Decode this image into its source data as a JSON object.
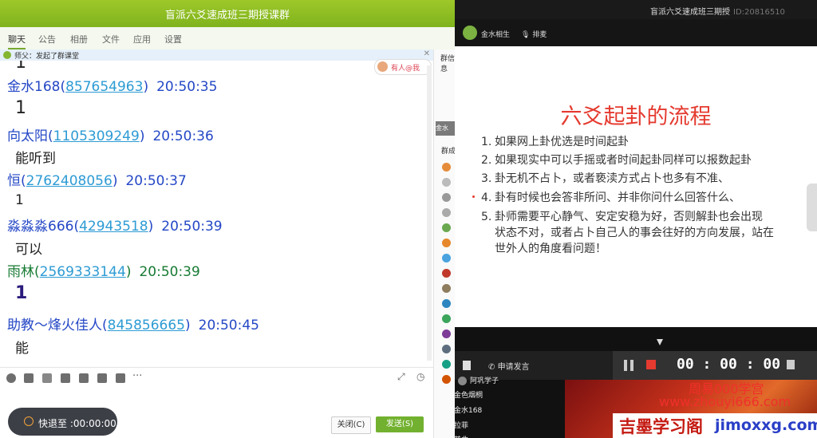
{
  "qq": {
    "title": "盲派六爻速成班三期授课群",
    "tabs": [
      "聊天",
      "公告",
      "相册",
      "文件",
      "应用",
      "设置"
    ],
    "notice": "师父：发起了群课堂",
    "mention": "有人@我",
    "messages": [
      {
        "name": "金水168",
        "qq": "857654963",
        "time": "20:50:35",
        "text": "1"
      },
      {
        "name": "向太阳",
        "qq": "1105309249",
        "time": "20:50:36",
        "text": "能听到"
      },
      {
        "name": "恒",
        "qq": "2762408056",
        "time": "20:50:37",
        "text": "1"
      },
      {
        "name": "淼淼淼666",
        "qq": "42943518",
        "time": "20:50:39",
        "text": "可以"
      },
      {
        "name": "雨林",
        "qq": "2569333144",
        "time": "20:50:39",
        "text": "1"
      },
      {
        "name": "助教～烽火佳人",
        "qq": "845856665",
        "time": "20:50:45",
        "text": "能"
      }
    ],
    "retreat": "快退至 :00:00:00",
    "close_btn": "关闭(C)",
    "send_btn": "发送(S)"
  },
  "group": {
    "info_label": "群信息",
    "members_label": "群成",
    "members": [
      "阿巩学子",
      "金色烟桐",
      "金水168",
      "拉菲",
      "普曲"
    ]
  },
  "live": {
    "title": "盲派六爻速成班三期授",
    "room_id": "ID:20816510",
    "host": "金水相生",
    "mic": "排麦",
    "slide_title": "六爻起卦的流程",
    "items": [
      {
        "n": "1.",
        "lines": [
          "如果网上卦优选是时间起卦"
        ]
      },
      {
        "n": "2.",
        "lines": [
          "如果现实中可以手摇或者时间起卦同样可以报数起卦"
        ]
      },
      {
        "n": "3.",
        "lines": [
          "卦无机不占卜，或者亵渎方式占卜也多有不准、"
        ]
      },
      {
        "n": "4.",
        "lines": [
          "卦有时候也会答非所问、并非你问什么回答什么、"
        ]
      },
      {
        "n": "5.",
        "lines": [
          "卦师需要平心静气、安定安稳为好，否则解卦也会出现",
          "状态不对，或者占卜自己人的事会往好的方向发展，站在",
          "世外人的角度看问题！"
        ]
      }
    ],
    "apply": "申请发言",
    "timer": "00 : 00 : 00",
    "watermark1": "周易000学宫",
    "watermark2": "www.zhouyi666.com",
    "site_cn": "吉墨学习阁",
    "site_en": "jimoxxg.com"
  },
  "colors": {
    "qq_green": "#7fb31c",
    "name_blue": "#2447c6",
    "slide_red": "#e53a2f"
  }
}
